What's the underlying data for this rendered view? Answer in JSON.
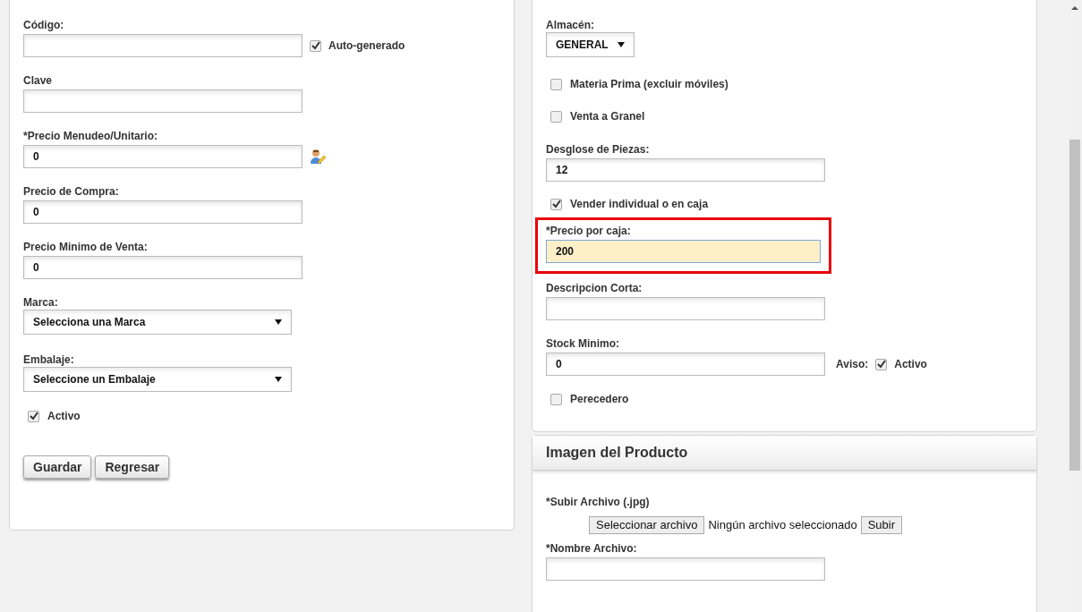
{
  "left_panel": {
    "fields": [
      {
        "kind": "text",
        "label": "Código:",
        "side_checkbox": {
          "label": "Auto-generado",
          "checked": true
        }
      },
      {
        "kind": "text",
        "label": "Clave"
      },
      {
        "kind": "lookup",
        "label": "*Precio Menudeo/Unitario:",
        "value": "0"
      },
      {
        "kind": "text",
        "label": "Precio de Compra:",
        "value": "0"
      },
      {
        "kind": "text",
        "label": "Precio Minimo de Venta:",
        "value": "0"
      },
      {
        "kind": "select",
        "label": "Marca:",
        "value": "Selecciona una Marca"
      },
      {
        "kind": "select",
        "label": "Embalaje:",
        "value": "Seleccione un Embalaje"
      },
      {
        "kind": "checkbox",
        "label": "Activo",
        "checked": true
      }
    ],
    "buttons": [
      "Guardar",
      "Regresar"
    ]
  },
  "right_panel": {
    "fields": [
      {
        "kind": "select",
        "label": "Almacén:",
        "value": "GENERAL"
      },
      {
        "kind": "checkbox",
        "label": "Materia Prima (excluir móviles)",
        "checked": false
      },
      {
        "kind": "checkbox",
        "label": "Venta a Granel",
        "checked": false
      },
      {
        "kind": "text",
        "label": "Desglose de Piezas:",
        "value": "12"
      },
      {
        "kind": "checkbox",
        "label": "Vender individual o en caja",
        "checked": true
      },
      {
        "kind": "text",
        "label": "*Precio por caja:",
        "value": "200",
        "focused": true,
        "highlighted": true
      },
      {
        "kind": "text",
        "label": "Descripcion Corta:"
      },
      {
        "kind": "text",
        "label": "Stock Minimo:",
        "value": "0",
        "side_label": "Aviso:",
        "side_checkbox": {
          "label": "Activo",
          "checked": true
        }
      },
      {
        "kind": "checkbox",
        "label": "Perecedero",
        "checked": false
      }
    ]
  },
  "image_panel": {
    "title": "Imagen del Producto",
    "upload": {
      "label": "*Subir Archivo (.jpg)",
      "choose_button": "Seleccionar archivo",
      "file_status": "Ningún archivo seleccionado",
      "upload_button": "Subir"
    },
    "fields": [
      {
        "kind": "text",
        "label": "*Nombre Archivo:"
      }
    ]
  }
}
